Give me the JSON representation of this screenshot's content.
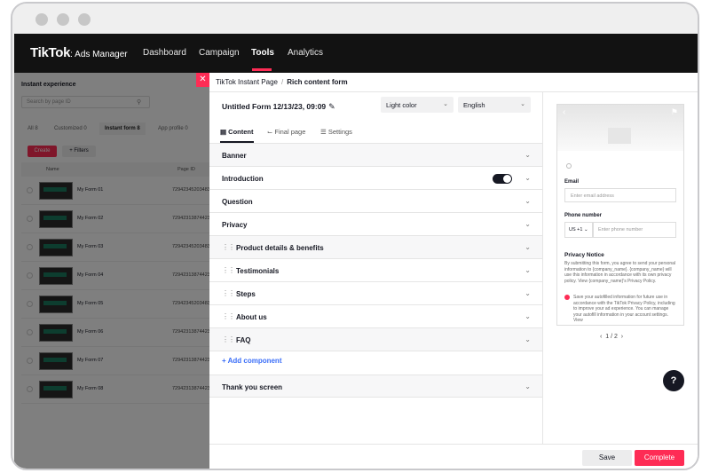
{
  "topnav": {
    "logo": "TikTok",
    "logo_sub": ": Ads Manager",
    "items": [
      "Dashboard",
      "Campaign",
      "Tools",
      "Analytics"
    ],
    "active": "Tools"
  },
  "background_page": {
    "title": "Instant experience",
    "search_placeholder": "Search by page ID",
    "tabs": [
      "All 8",
      "Customized 0",
      "Instant form 8",
      "App profile 0"
    ],
    "create_label": "Create",
    "filters_label": "+ Filters",
    "columns": [
      "Name",
      "Page ID"
    ],
    "rows": [
      {
        "name": "My Form 01",
        "id": "729423452034834..."
      },
      {
        "name": "My Form 02",
        "id": "729423138744236..."
      },
      {
        "name": "My Form 03",
        "id": "729423452034834..."
      },
      {
        "name": "My Form 04",
        "id": "729423138744236..."
      },
      {
        "name": "My Form 05",
        "id": "729423452034834..."
      },
      {
        "name": "My Form 06",
        "id": "729423138744236..."
      },
      {
        "name": "My Form 07",
        "id": "729423138744236..."
      },
      {
        "name": "My Form 08",
        "id": "729423138744236..."
      }
    ]
  },
  "breadcrumb": {
    "parent": "TikTok Instant Page",
    "separator": "/",
    "current": "Rich content form"
  },
  "form": {
    "title": "Untitled Form 12/13/23, 09:09",
    "color_mode": "Light color",
    "language": "English"
  },
  "tabs": [
    "Content",
    "Final page",
    "Settings"
  ],
  "sections": [
    {
      "label": "Banner",
      "draggable": false
    },
    {
      "label": "Introduction",
      "draggable": false,
      "toggle": true
    },
    {
      "label": "Question",
      "draggable": false
    },
    {
      "label": "Privacy",
      "draggable": false
    },
    {
      "label": "Product details & benefits",
      "draggable": true
    },
    {
      "label": "Testimonials",
      "draggable": true
    },
    {
      "label": "Steps",
      "draggable": true
    },
    {
      "label": "About us",
      "draggable": true
    },
    {
      "label": "FAQ",
      "draggable": true
    }
  ],
  "add_component": "+ Add component",
  "thank_you": "Thank you screen",
  "preview": {
    "email_label": "Email",
    "email_placeholder": "Enter email address",
    "phone_label": "Phone number",
    "country_code": "US +1",
    "phone_placeholder": "Enter phone number",
    "privacy_title": "Privacy Notice",
    "privacy_text": "By submitting this form, you agree to send your personal information to {company_name}. {company_name} will use this information in accordance with its own privacy policy. View {company_name}'s Privacy Policy.",
    "consent_text": "Save your autofilled information for future use in accordance with the TikTok Privacy Policy, including to improve your ad experience. You can manage your autofill information in your account settings. View",
    "pager": "1 / 2"
  },
  "help_label": "?",
  "footer": {
    "save": "Save",
    "complete": "Complete"
  },
  "colors": {
    "accent": "#fe2c55",
    "link": "#3b6ef8",
    "nav_bg": "#121212"
  }
}
